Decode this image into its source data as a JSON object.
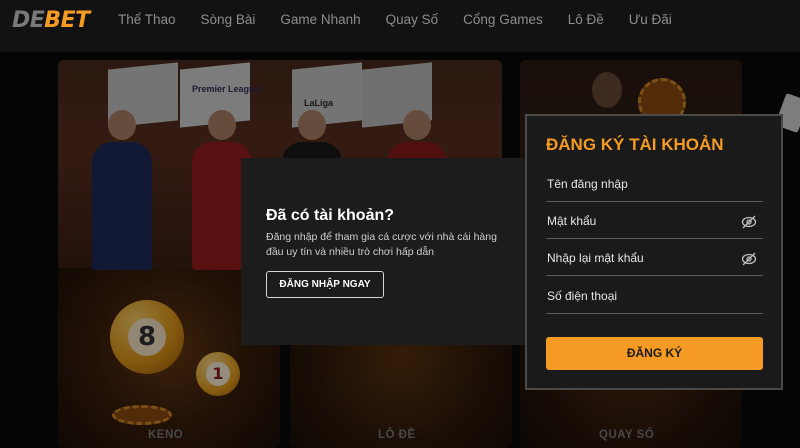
{
  "brand": {
    "logo_prefix": "DE",
    "logo_suffix": "BET",
    "accent_color": "#f59a23"
  },
  "nav": {
    "items": [
      {
        "label": "Thể Thao"
      },
      {
        "label": "Sòng Bài"
      },
      {
        "label": "Game Nhanh"
      },
      {
        "label": "Quay Số"
      },
      {
        "label": "Cổng Games"
      },
      {
        "label": "Lô Đề"
      },
      {
        "label": "Ưu Đãi"
      }
    ]
  },
  "banner": {
    "flags": [
      "Premier League",
      "LaLiga"
    ],
    "balls": [
      "8",
      "1"
    ],
    "games": [
      {
        "label": "KENO"
      },
      {
        "label": "LÔ ĐỀ"
      },
      {
        "label": "QUAY SỐ"
      }
    ]
  },
  "login_prompt": {
    "title": "Đã có tài khoản?",
    "description": "Đăng nhập để tham gia cá cược với nhà cái hàng đầu uy tín và nhiều trò chơi hấp dẫn",
    "button_label": "ĐĂNG NHẬP NGAY"
  },
  "register": {
    "title": "ĐĂNG KÝ TÀI KHOẢN",
    "fields": [
      {
        "placeholder": "Tên đăng nhập",
        "icon": null
      },
      {
        "placeholder": "Mật khẩu",
        "icon": "eye-slash-icon"
      },
      {
        "placeholder": "Nhập lại mật khẩu",
        "icon": "eye-slash-icon"
      },
      {
        "placeholder": "Số điện thoại",
        "icon": null
      }
    ],
    "submit_label": "ĐĂNG KÝ"
  }
}
